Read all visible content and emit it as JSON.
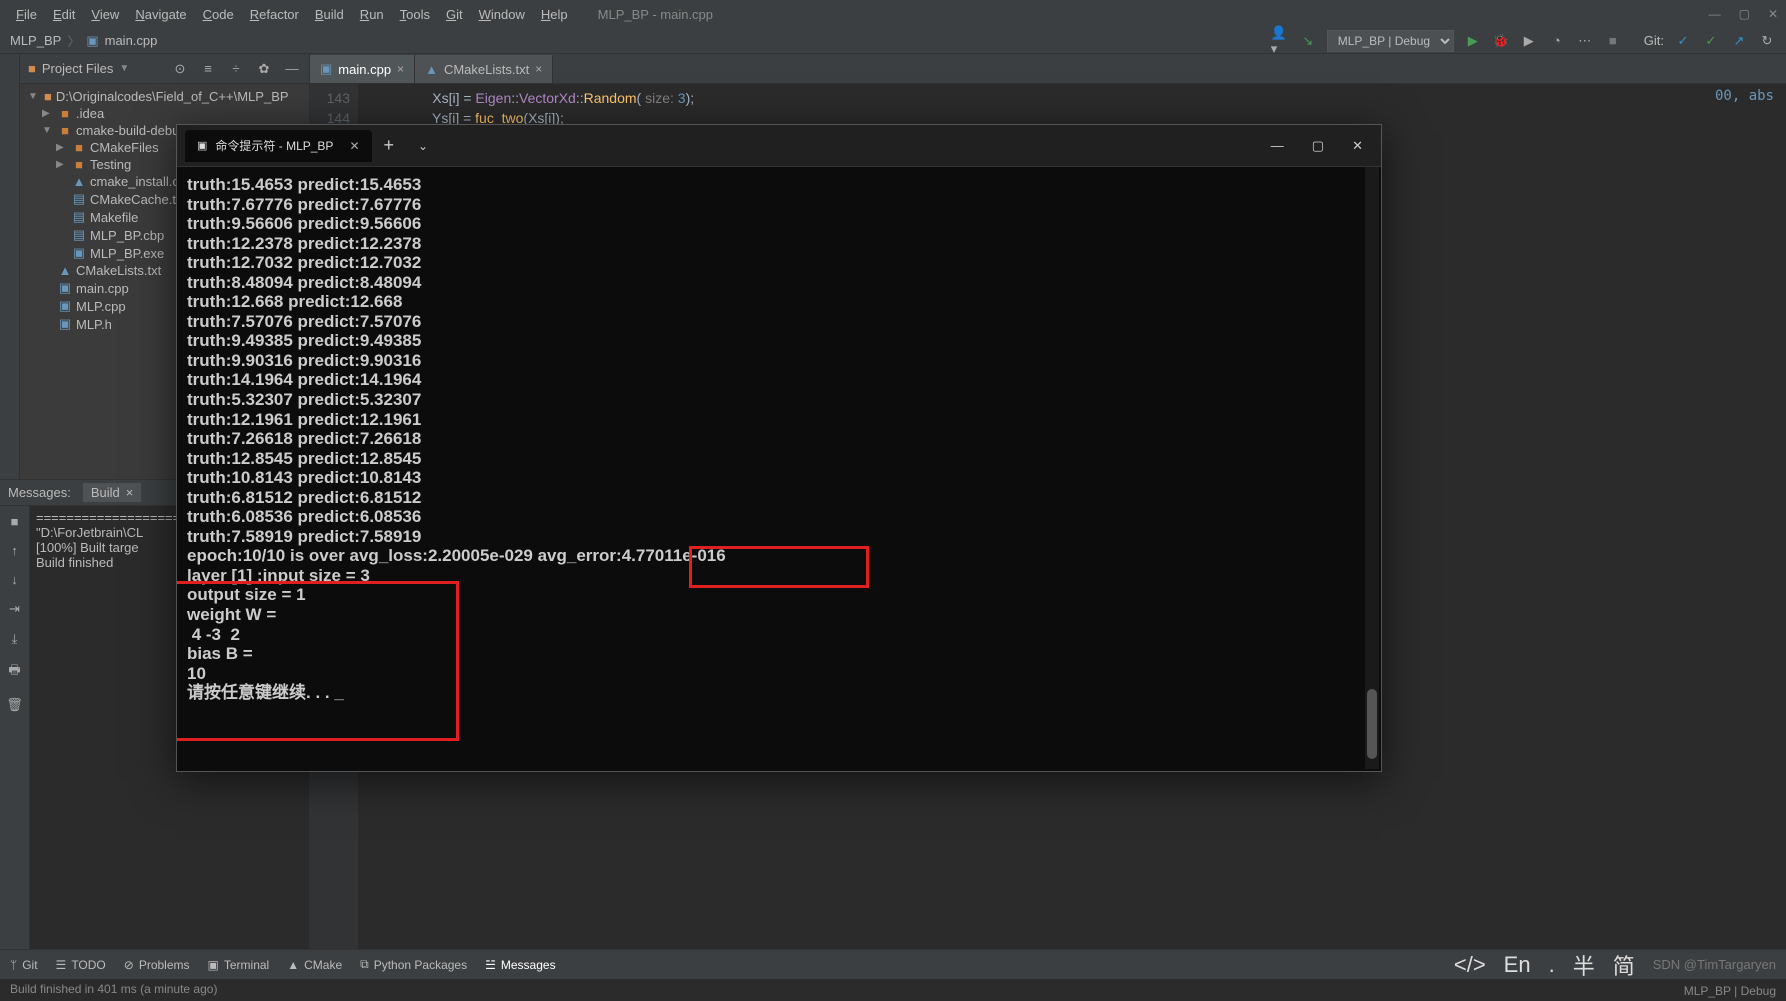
{
  "menubar": {
    "items": [
      "File",
      "Edit",
      "View",
      "Navigate",
      "Code",
      "Refactor",
      "Build",
      "Run",
      "Tools",
      "Git",
      "Window",
      "Help"
    ],
    "title": "MLP_BP - main.cpp"
  },
  "breadcrumbs": {
    "root": "MLP_BP",
    "file": "main.cpp"
  },
  "runconfig": {
    "selected": "MLP_BP | Debug",
    "git_label": "Git:"
  },
  "sidebar": {
    "title": "Project Files",
    "root": "D:\\Originalcodes\\Field_of_C++\\MLP_BP",
    "nodes": [
      {
        "name": ".idea",
        "type": "folder",
        "indent": 1,
        "caret": "▶"
      },
      {
        "name": "cmake-build-debu",
        "type": "folder",
        "indent": 1,
        "caret": "▼"
      },
      {
        "name": "CMakeFiles",
        "type": "folder",
        "indent": 2,
        "caret": "▶"
      },
      {
        "name": "Testing",
        "type": "folder",
        "indent": 2,
        "caret": "▶"
      },
      {
        "name": "cmake_install.cr",
        "type": "cmake",
        "indent": 2
      },
      {
        "name": "CMakeCache.tx",
        "type": "file",
        "indent": 2
      },
      {
        "name": "Makefile",
        "type": "file",
        "indent": 2
      },
      {
        "name": "MLP_BP.cbp",
        "type": "file",
        "indent": 2
      },
      {
        "name": "MLP_BP.exe",
        "type": "exe",
        "indent": 2
      },
      {
        "name": "CMakeLists.txt",
        "type": "cmake",
        "indent": 1
      },
      {
        "name": "main.cpp",
        "type": "cpp",
        "indent": 1
      },
      {
        "name": "MLP.cpp",
        "type": "cpp",
        "indent": 1
      },
      {
        "name": "MLP.h",
        "type": "h",
        "indent": 1
      }
    ]
  },
  "tabs": [
    {
      "label": "main.cpp",
      "icon": "cpp",
      "active": true
    },
    {
      "label": "CMakeLists.txt",
      "icon": "cmake",
      "active": false
    }
  ],
  "code": {
    "lines": [
      {
        "num": "143",
        "text": "Xs[i] = Eigen::VectorXd::Random( size: 3);"
      },
      {
        "num": "144",
        "text": "Ys[i] = fuc_two(Xs[i]);"
      }
    ],
    "hint": "00, abs"
  },
  "messages": {
    "label": "Messages:",
    "tab": "Build",
    "lines": [
      "================================",
      "\"D:\\ForJetbrain\\CL",
      "[100%] Built targe",
      "",
      "Build finished"
    ]
  },
  "terminal": {
    "tab_title": "命令提示符 - MLP_BP",
    "output": [
      "truth:15.4653 predict:15.4653",
      "truth:7.67776 predict:7.67776",
      "truth:9.56606 predict:9.56606",
      "truth:12.2378 predict:12.2378",
      "truth:12.7032 predict:12.7032",
      "truth:8.48094 predict:8.48094",
      "truth:12.668 predict:12.668",
      "truth:7.57076 predict:7.57076",
      "truth:9.49385 predict:9.49385",
      "truth:9.90316 predict:9.90316",
      "truth:14.1964 predict:14.1964",
      "truth:5.32307 predict:5.32307",
      "truth:12.1961 predict:12.1961",
      "truth:7.26618 predict:7.26618",
      "truth:12.8545 predict:12.8545",
      "truth:10.8143 predict:10.8143",
      "truth:6.81512 predict:6.81512",
      "truth:6.08536 predict:6.08536",
      "truth:7.58919 predict:7.58919",
      "epoch:10/10 is over avg_loss:2.20005e-029 avg_error:4.77011e-016",
      "",
      "layer [1] :input size = 3",
      "output size = 1",
      "weight W =",
      " 4 -3  2",
      "bias B =",
      "10",
      "",
      "请按任意键继续. . . _"
    ]
  },
  "toolwindows": [
    {
      "label": "Git",
      "icon": "branch"
    },
    {
      "label": "TODO",
      "icon": "todo"
    },
    {
      "label": "Problems",
      "icon": "problems"
    },
    {
      "label": "Terminal",
      "icon": "terminal"
    },
    {
      "label": "CMake",
      "icon": "cmake"
    },
    {
      "label": "Python Packages",
      "icon": "py"
    },
    {
      "label": "Messages",
      "icon": "msg",
      "active": true
    }
  ],
  "bottomright": {
    "code": "</>",
    "lang": "En",
    "dot": ".",
    "han1": "半",
    "han2": "简",
    "watermark": "SDN @TimTargaryen",
    "status_right": "MLP_BP | Debug"
  },
  "status": {
    "text": "Build finished in 401 ms (a minute ago)"
  }
}
